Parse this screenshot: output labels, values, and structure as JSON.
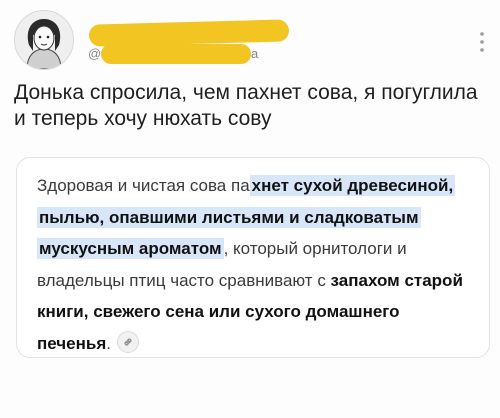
{
  "post": {
    "author": {
      "handle_prefix": "@",
      "handle_suffix": "a"
    },
    "text": "Донька спросила, чем пахнет сова, я погуглила и теперь хочу нюхать сову"
  },
  "snippet": {
    "intro": "Здоровая и чистая сова па",
    "highlight": "хнет сухой древесиной, пылью, опавшими листьями и сладковатым мускусным ароматом",
    "middle": ", который орнитологи и владельцы птиц часто сравнивают с ",
    "bold_tail": "запахом старой книги, свежего сена или сухого домашнего печенья",
    "end": "."
  },
  "icons": {
    "more": "vertical-dots-icon",
    "source_link": "link-icon",
    "avatar": "user-drawing-avatar"
  },
  "colors": {
    "redaction": "#f2c522",
    "highlight_bg": "#d8e6f9",
    "card_border": "#e3e3e3"
  }
}
